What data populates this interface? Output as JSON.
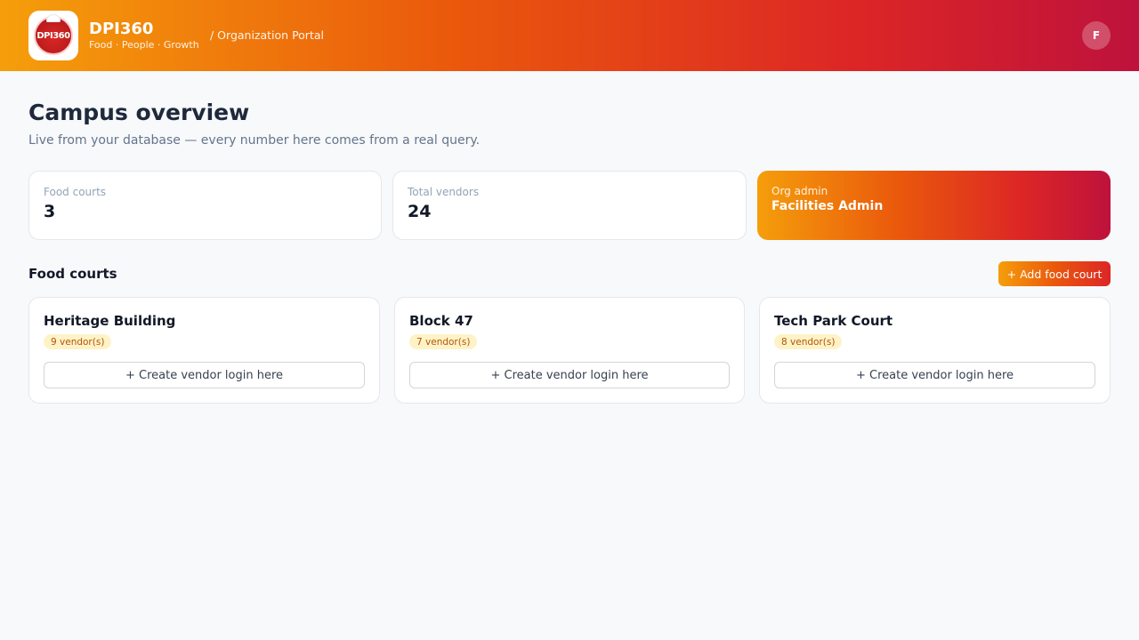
{
  "header": {
    "logo_icon": "dpi360-logo-icon",
    "logo_mark": "DPI360",
    "brand_name": "DPI360",
    "tagline": "Food · People · Growth",
    "portal_label": "/ Organization Portal",
    "avatar_initial": "F",
    "gradient_colors": [
      "#f59e0b",
      "#ea580c",
      "#dc2626",
      "#be123c"
    ]
  },
  "main": {
    "title": "Campus overview",
    "subtitle": "Live from your database — every number here comes from a real query."
  },
  "stats": {
    "food_courts": {
      "label": "Food courts",
      "value": "3"
    },
    "total_vendors": {
      "label": "Total vendors",
      "value": "24"
    },
    "org_admin": {
      "label": "Org admin",
      "value": "Facilities Admin"
    }
  },
  "food_courts_section": {
    "title": "Food courts",
    "add_button_label": "+ Add food court",
    "courts": [
      {
        "name": "Heritage Building",
        "vendors": "9 vendor(s)",
        "action_label": "+ Create vendor login here"
      },
      {
        "name": "Block 47",
        "vendors": "7 vendor(s)",
        "action_label": "+ Create vendor login here"
      },
      {
        "name": "Tech Park Court",
        "vendors": "8 vendor(s)",
        "action_label": "+ Create vendor login here"
      }
    ]
  }
}
